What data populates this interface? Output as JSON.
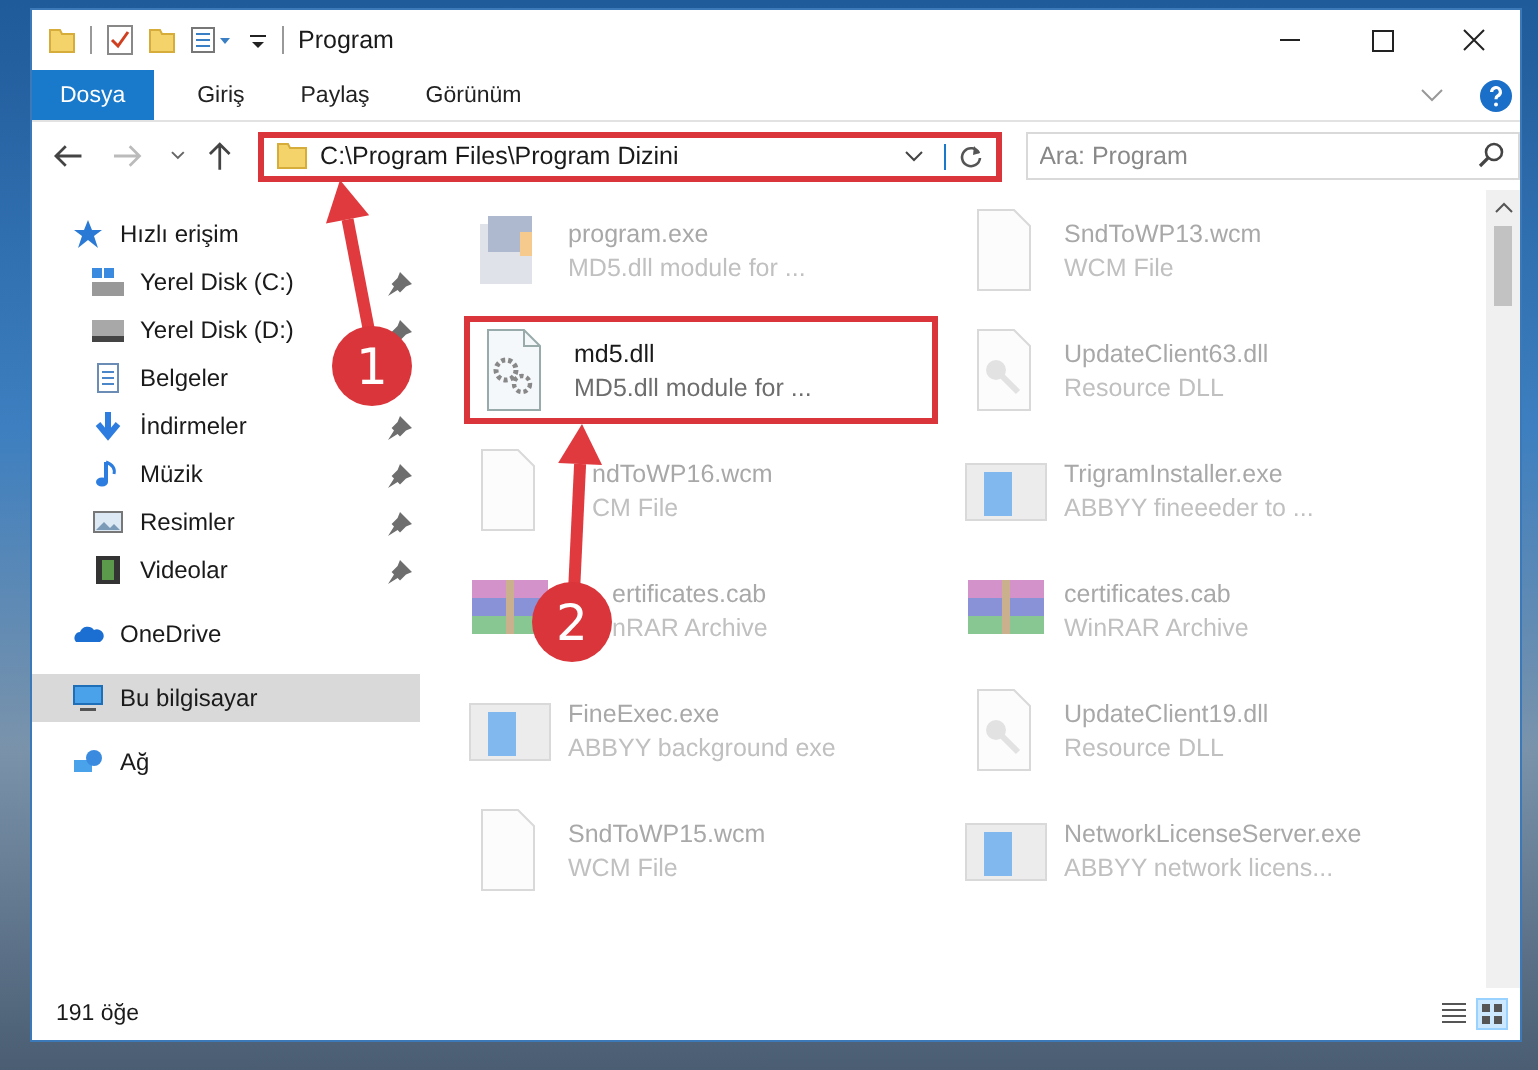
{
  "window": {
    "title": "Program"
  },
  "ribbon_tabs": [
    {
      "label": "Dosya",
      "selected": true
    },
    {
      "label": "Giriş",
      "selected": false
    },
    {
      "label": "Paylaş",
      "selected": false
    },
    {
      "label": "Görünüm",
      "selected": false
    }
  ],
  "address_bar": {
    "path": "C:\\Program Files\\Program Dizini",
    "highlighted": true
  },
  "search": {
    "placeholder": "Ara: Program"
  },
  "sidebar": {
    "items": [
      {
        "label": "Hızlı erişim",
        "kind": "star",
        "selected": false,
        "children": [
          {
            "label": "Yerel Disk (C:)",
            "kind": "drive-c",
            "pinned": true,
            "selected": false
          },
          {
            "label": "Yerel Disk (D:)",
            "kind": "drive",
            "pinned": true,
            "selected": false
          },
          {
            "label": "Belgeler",
            "kind": "documents",
            "pinned": false,
            "selected": false
          },
          {
            "label": "İndirmeler",
            "kind": "downloads",
            "pinned": true,
            "selected": false
          },
          {
            "label": "Müzik",
            "kind": "music",
            "pinned": true,
            "selected": false
          },
          {
            "label": "Resimler",
            "kind": "pictures",
            "pinned": true,
            "selected": false
          },
          {
            "label": "Videolar",
            "kind": "videos",
            "pinned": true,
            "selected": false
          }
        ]
      },
      {
        "label": "OneDrive",
        "kind": "cloud",
        "selected": false
      },
      {
        "label": "Bu bilgisayar",
        "kind": "computer",
        "selected": true
      },
      {
        "label": "Ağ",
        "kind": "network",
        "selected": false
      }
    ]
  },
  "files": [
    {
      "name": "program.exe",
      "description": "MD5.dll module for ...",
      "kind": "installer",
      "faded": true,
      "highlighted": false
    },
    {
      "name": "SndToWP13.wcm",
      "description": "WCM File",
      "kind": "blank",
      "faded": true,
      "highlighted": false
    },
    {
      "name": "md5.dll",
      "description": "MD5.dll module for ...",
      "kind": "gears",
      "faded": false,
      "highlighted": true
    },
    {
      "name": "UpdateClient63.dll",
      "description": "Resource DLL",
      "kind": "key",
      "faded": true,
      "highlighted": false
    },
    {
      "name": "ndToWP16.wcm",
      "description": "CM File",
      "kind": "blank",
      "faded": true,
      "highlighted": false
    },
    {
      "name": "TrigramInstaller.exe",
      "description": "ABBYY fineeeder to ...",
      "kind": "app",
      "faded": true,
      "highlighted": false
    },
    {
      "name": "ertificates.cab",
      "description": "nRAR Archive",
      "kind": "archive",
      "faded": true,
      "highlighted": false
    },
    {
      "name": "certificates.cab",
      "description": "WinRAR Archive",
      "kind": "archive",
      "faded": true,
      "highlighted": false
    },
    {
      "name": "FineExec.exe",
      "description": "ABBYY background exe",
      "kind": "app",
      "faded": true,
      "highlighted": false
    },
    {
      "name": "UpdateClient19.dll",
      "description": "Resource DLL",
      "kind": "key",
      "faded": true,
      "highlighted": false
    },
    {
      "name": "SndToWP15.wcm",
      "description": "WCM File",
      "kind": "blank",
      "faded": true,
      "highlighted": false
    },
    {
      "name": "NetworkLicenseServer.exe",
      "description": "ABBYY network licens...",
      "kind": "app",
      "faded": true,
      "highlighted": false
    }
  ],
  "status_bar": {
    "item_count": "191 öğe"
  },
  "annotations": [
    {
      "label": "1"
    },
    {
      "label": "2"
    }
  ]
}
